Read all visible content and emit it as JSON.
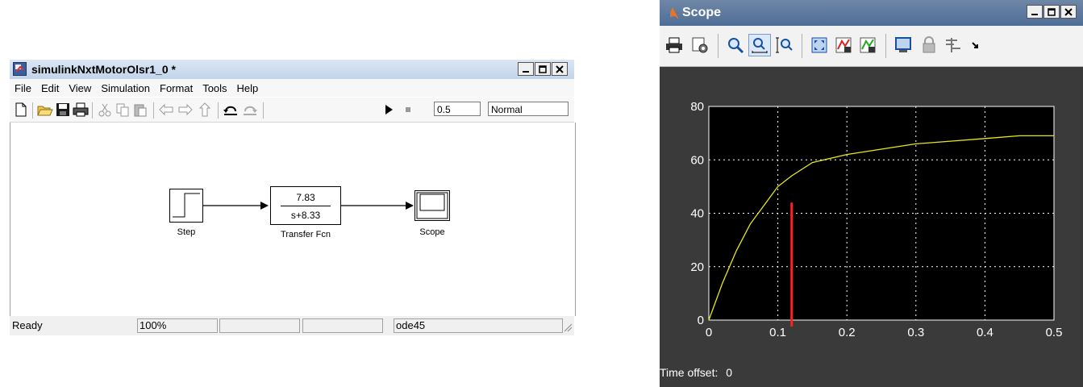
{
  "model_window": {
    "title": "simulinkNxtMotorOlsr1_0 *",
    "menu": [
      "File",
      "Edit",
      "View",
      "Simulation",
      "Format",
      "Tools",
      "Help"
    ],
    "stop_time": "0.5",
    "sim_mode": "Normal",
    "blocks": {
      "step_label": "Step",
      "transfer_numerator": "7.83",
      "transfer_denominator": "s+8.33",
      "transfer_label": "Transfer Fcn",
      "scope_label": "Scope"
    },
    "status": {
      "state": "Ready",
      "zoom": "100%",
      "cell3": "",
      "cell4": "",
      "solver": "ode45"
    }
  },
  "scope_window": {
    "title": "Scope",
    "time_offset_label": "Time offset:",
    "time_offset_value": "0",
    "colors": {
      "trace": "#e8e817",
      "marker": "#ff2020",
      "plot_bg": "#000000",
      "frame_bg": "#3a3a3a"
    }
  },
  "chart_data": {
    "type": "line",
    "title": "",
    "xlabel": "",
    "ylabel": "",
    "xlim": [
      0,
      0.5
    ],
    "ylim": [
      0,
      80
    ],
    "x_ticks": [
      "0",
      "0.1",
      "0.2",
      "0.3",
      "0.4",
      "0.5"
    ],
    "y_ticks": [
      "0",
      "20",
      "40",
      "60",
      "80"
    ],
    "grid": true,
    "series": [
      {
        "x": [
          0,
          0.02,
          0.04,
          0.06,
          0.08,
          0.1,
          0.12,
          0.15,
          0.2,
          0.25,
          0.3,
          0.35,
          0.4,
          0.45,
          0.5
        ],
        "y": [
          0,
          14,
          26,
          36,
          43,
          50,
          54,
          59,
          62,
          64,
          66,
          67,
          68,
          69,
          69
        ]
      }
    ],
    "marker_line": {
      "x": 0.12,
      "y_top": 44
    }
  }
}
